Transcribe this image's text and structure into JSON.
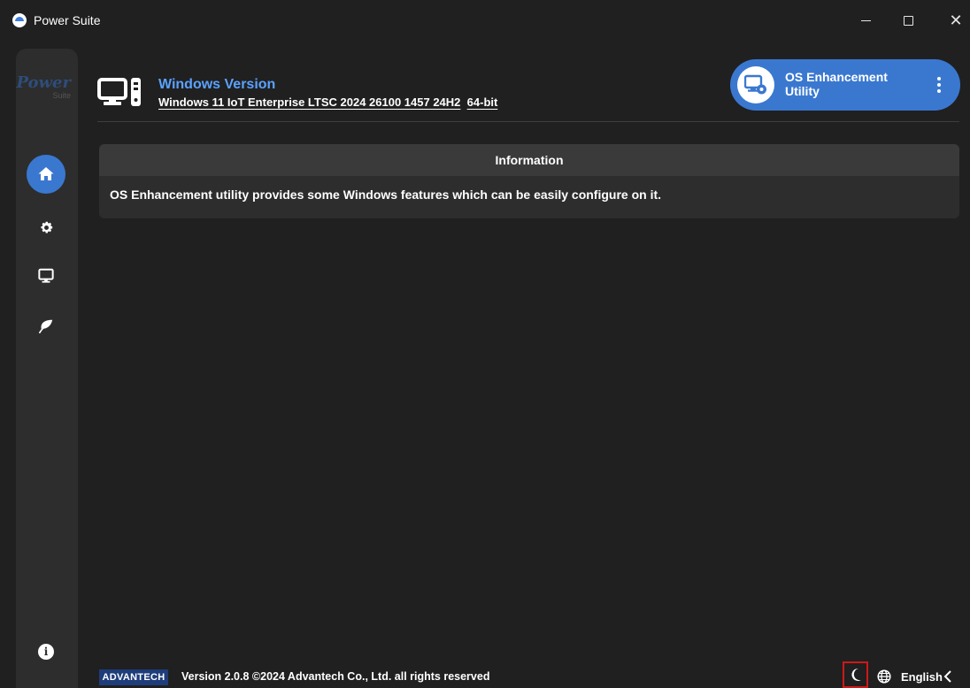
{
  "window": {
    "title": "Power Suite",
    "close_glyph": "✕"
  },
  "sidebar": {
    "logo_main": "Power",
    "logo_sub": "Suite",
    "items": [
      {
        "icon": "home-icon",
        "active": true
      },
      {
        "icon": "gear-icon",
        "active": false
      },
      {
        "icon": "monitor-icon",
        "active": false
      },
      {
        "icon": "leaf-icon",
        "active": false
      }
    ],
    "info_glyph": "i"
  },
  "header": {
    "title": "Windows Version",
    "os_name": "Windows 11 IoT Enterprise LTSC 2024 26100 1457 24H2",
    "arch": "64-bit"
  },
  "utility": {
    "label": "OS Enhancement Utility"
  },
  "info_card": {
    "heading": "Information",
    "body": "OS Enhancement utility provides some Windows features which can be easily configure on it."
  },
  "footer": {
    "brand": "ADVANTECH",
    "version_text": "Version 2.0.8 ©2024 Advantech Co., Ltd. all rights reserved",
    "language": "English"
  },
  "colors": {
    "accent": "#3a78d0",
    "title_blue": "#5aa2ff",
    "background": "#202020",
    "panel": "#2d2d2d",
    "highlight_box": "#d01818"
  }
}
